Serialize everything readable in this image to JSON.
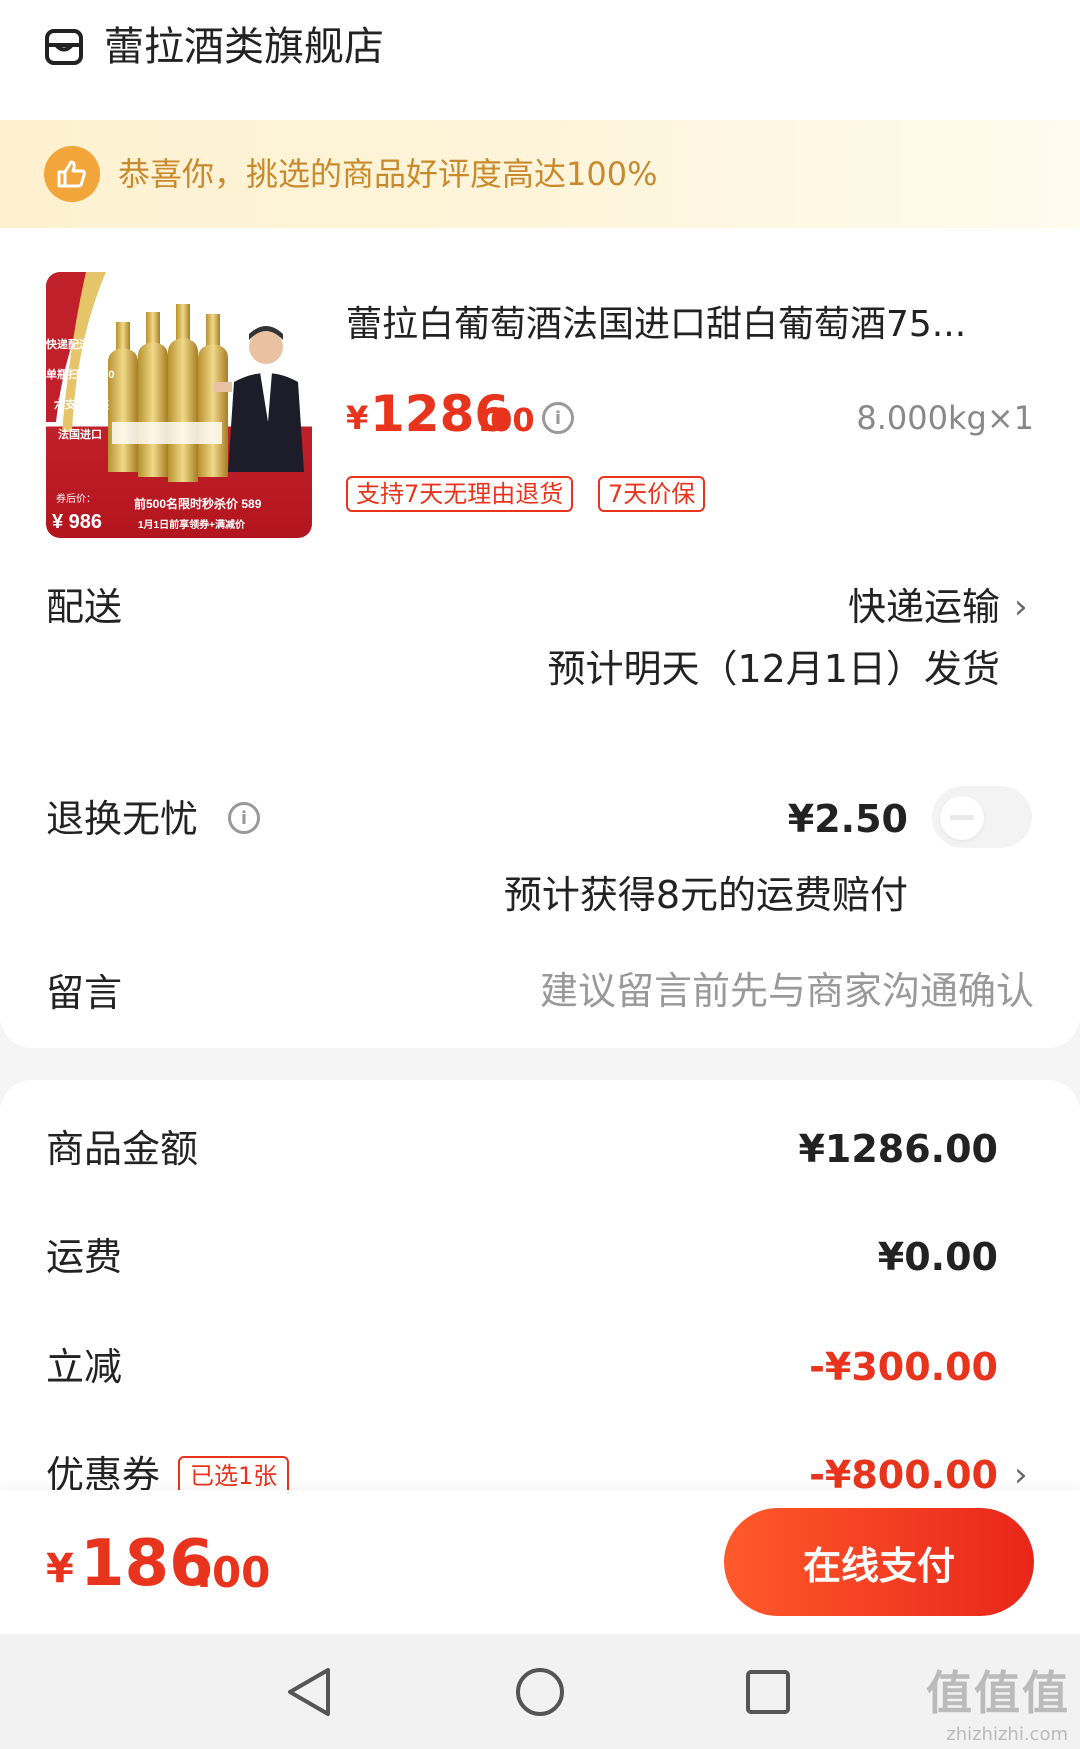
{
  "store": {
    "name": "蕾拉酒类旗舰店",
    "icon": "store-icon"
  },
  "banner": {
    "text": "恭喜你，挑选的商品好评度高达100%",
    "icon": "thumbs-up-icon"
  },
  "product": {
    "title": "蕾拉白葡萄酒法国进口甜白葡萄酒75...",
    "price_symbol": "¥",
    "price_int": "1286",
    "price_dec": ".00",
    "weight_qty": "8.000kg×1",
    "tags": [
      "支持7天无理由退货",
      "7天价保"
    ],
    "image_labels": {
      "top_badges": [
        "快递配送 京东",
        "单瓶扫码1890",
        "六支礼盒装",
        "法国进口"
      ],
      "after_coupon_label": "券后价：",
      "after_coupon_price": "¥ 986",
      "promo_line1": "前500名限时秒杀价 589",
      "promo_line2": "1月1日前享领券+满减价"
    }
  },
  "delivery": {
    "label": "配送",
    "method": "快递运输",
    "estimate": "预计明天（12月1日）发货"
  },
  "return_insurance": {
    "label": "退换无忧",
    "price": "¥2.50",
    "note": "预计获得8元的运费赔付"
  },
  "message": {
    "label": "留言",
    "placeholder": "建议留言前先与商家沟通确认"
  },
  "summary": {
    "goods_label": "商品金额",
    "goods_value": "¥1286.00",
    "shipping_label": "运费",
    "shipping_value": "¥0.00",
    "discount_label": "立减",
    "discount_value": "-¥300.00",
    "coupon_label": "优惠券",
    "coupon_tag": "已选1张",
    "coupon_value": "-¥800.00"
  },
  "pay": {
    "total_symbol": "¥",
    "total_int": "186",
    "total_dec": ".00",
    "button": "在线支付"
  },
  "watermark": {
    "text": "值值值",
    "sub": "zhizhizhi.com"
  },
  "colors": {
    "accent": "#e8341c",
    "banner_text": "#c98a2e",
    "banner_icon": "#f2a53a"
  }
}
